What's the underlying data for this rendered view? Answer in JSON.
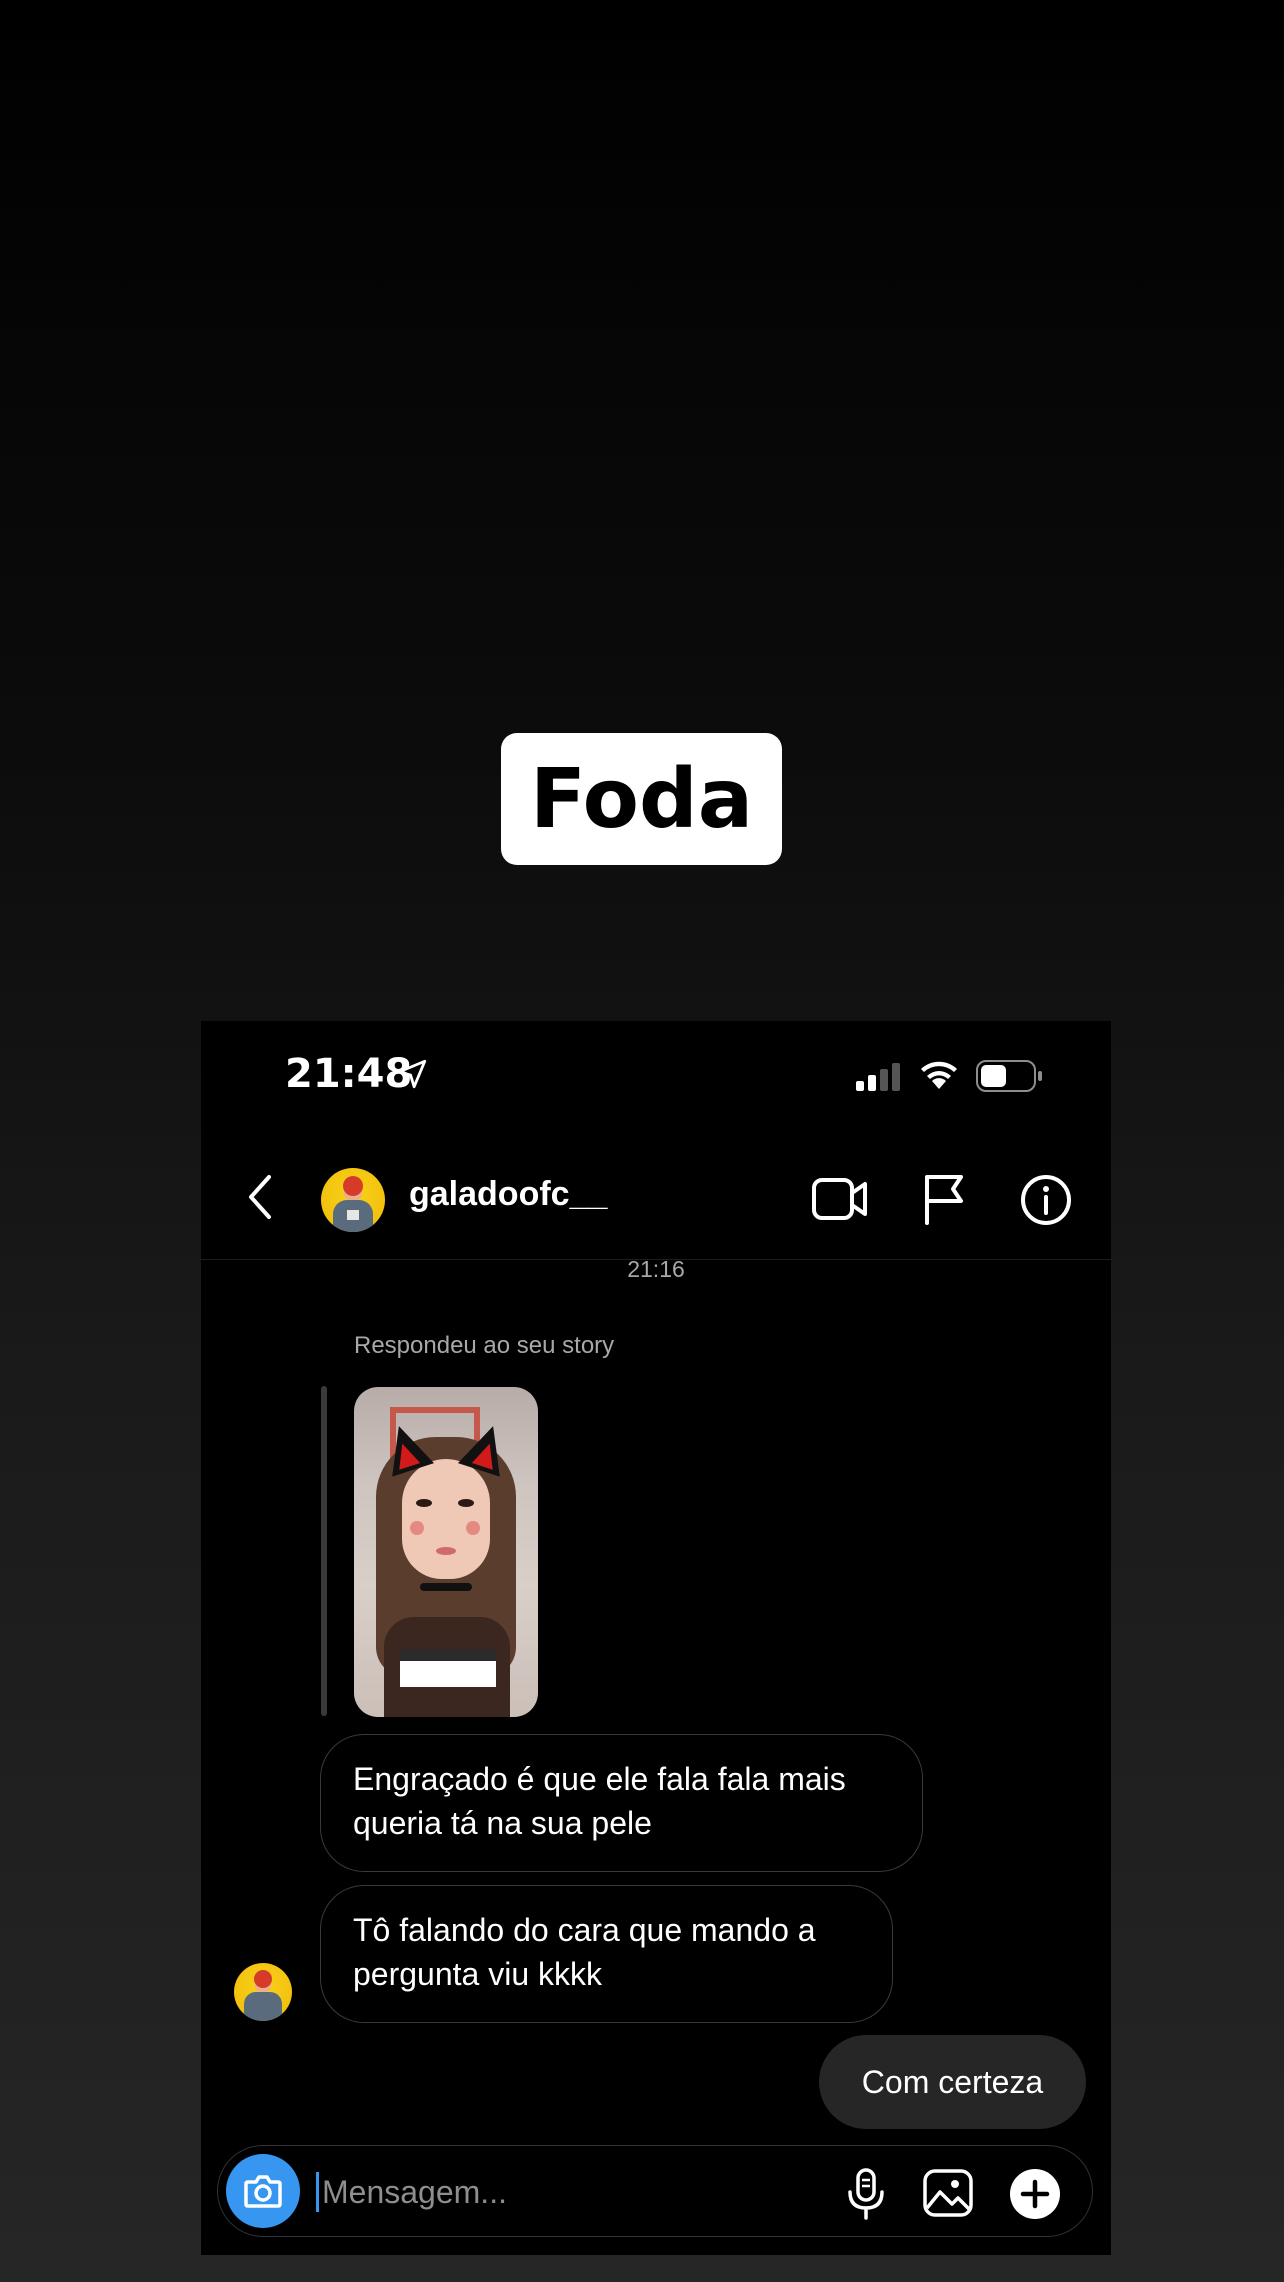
{
  "caption": {
    "text": "Foda"
  },
  "status_bar": {
    "time": "21:48",
    "battery_level_fraction": 0.5,
    "signal_bars": 2
  },
  "header": {
    "username": "galadoofc__"
  },
  "chat": {
    "timestamp": "21:16",
    "story_reply_label": "Respondeu ao seu story",
    "messages": [
      {
        "direction": "received",
        "text": "Engraçado é que ele fala fala mais queria tá na sua pele"
      },
      {
        "direction": "received",
        "text": "Tô falando do cara que mando a pergunta viu kkkk"
      },
      {
        "direction": "sent",
        "text": "Com certeza"
      }
    ]
  },
  "composer": {
    "placeholder": "Mensagem..."
  },
  "icons": {
    "location": "location-arrow-icon",
    "signal": "cellular-signal-icon",
    "wifi": "wifi-icon",
    "battery": "battery-icon",
    "back": "chevron-left-icon",
    "video": "video-call-icon",
    "flag": "flag-icon",
    "info": "info-icon",
    "camera": "camera-icon",
    "mic": "microphone-icon",
    "gallery": "gallery-icon",
    "plus": "plus-icon"
  },
  "colors": {
    "accent": "#3797f0",
    "background": "#000000",
    "sent_bubble": "#262626"
  }
}
